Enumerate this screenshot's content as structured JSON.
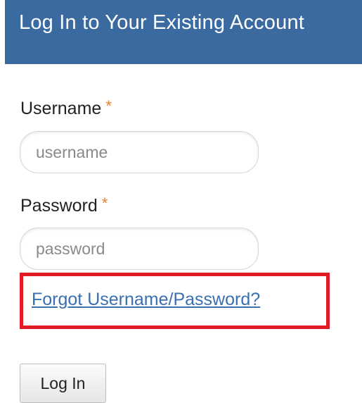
{
  "header": {
    "title": "Log In to Your Existing Account"
  },
  "form": {
    "username_label": "Username",
    "username_required": "*",
    "username_placeholder": "username",
    "username_value": "",
    "password_label": "Password",
    "password_required": "*",
    "password_placeholder": "password",
    "password_value": "",
    "forgot_link": "Forgot Username/Password?",
    "login_button": "Log In"
  },
  "colors": {
    "header_bg": "#3b6aa0",
    "required": "#e8812c",
    "link": "#3a6fb0",
    "highlight": "#e01b24"
  }
}
